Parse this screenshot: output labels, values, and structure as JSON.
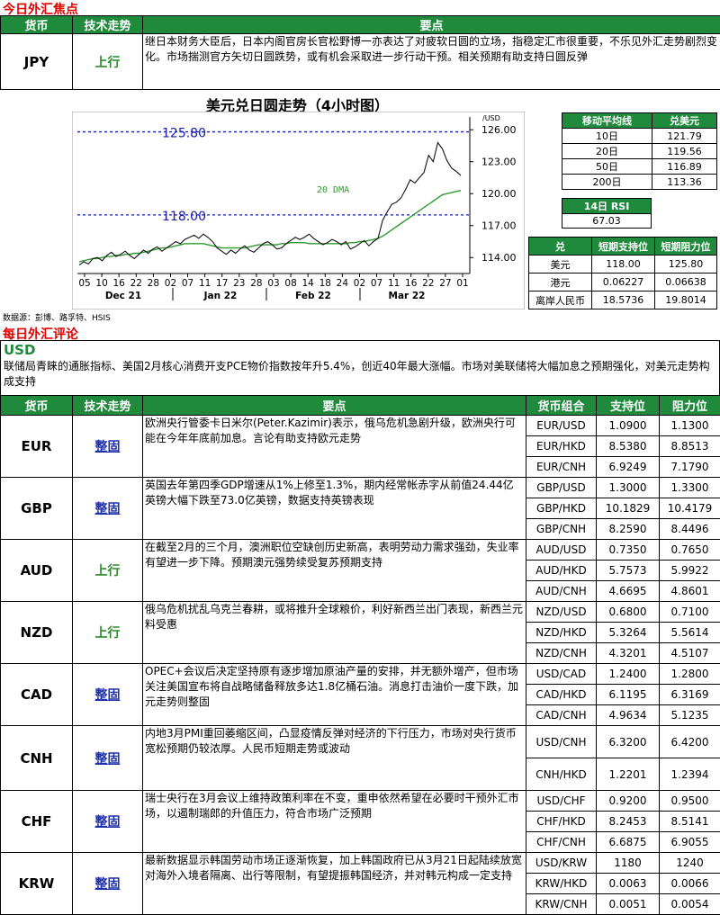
{
  "focus_title": "今日外汇焦点",
  "review_title": "每日外汇评论",
  "headers": {
    "currency": "货币",
    "trend": "技术走势",
    "points": "要点",
    "pair": "货币组合",
    "support": "支持位",
    "resistance": "阻力位"
  },
  "jpy": {
    "currency": "JPY",
    "trend": "上行",
    "text": "继日本财务大臣后，日本内阁官房长官松野博一亦表达了对疲软日圆的立场，指稳定汇市很重要，不乐见外汇走势剧烈变化。市场揣测官方矢切日圆跌势，或有机会采取进一步行动干预。相关预期有助支持日圆反弹"
  },
  "chart_data": {
    "type": "line",
    "title": "美元兑日圆走势（4小时图）",
    "y_unit": "/USD",
    "ylim": [
      112.5,
      127.2
    ],
    "y_ticks": [
      "126.00",
      "123.00",
      "120.00",
      "117.00",
      "114.00"
    ],
    "x_ticks": [
      "05",
      "10",
      "16",
      "22",
      "28",
      "02",
      "07",
      "11",
      "17",
      "23",
      "28",
      "03",
      "08",
      "14",
      "18",
      "24",
      "02",
      "07",
      "11",
      "16",
      "22",
      "27",
      "01"
    ],
    "x_groups": [
      "Dec 21",
      "Jan 22",
      "Feb 22",
      "Mar 22"
    ],
    "hlines": [
      {
        "value": 125.8,
        "label": "125.80"
      },
      {
        "value": 118.0,
        "label": "118.00"
      }
    ],
    "ma_label": "20 DMA",
    "price": [
      113.3,
      113.6,
      113.4,
      113.9,
      114.0,
      113.7,
      114.2,
      114.5,
      114.1,
      114.3,
      114.6,
      114.2,
      113.9,
      114.3,
      114.7,
      114.4,
      114.8,
      115.0,
      114.6,
      114.9,
      115.2,
      115.5,
      115.3,
      115.7,
      115.9,
      116.1,
      115.8,
      116.2,
      115.9,
      115.5,
      114.9,
      114.6,
      114.3,
      114.7,
      114.4,
      114.8,
      115.1,
      114.7,
      114.5,
      114.9,
      115.3,
      115.5,
      115.2,
      114.8,
      114.9,
      115.3,
      115.6,
      115.9,
      115.7,
      115.9,
      116.2,
      115.8,
      115.5,
      115.2,
      115.4,
      115.7,
      115.5,
      115.2,
      115.5,
      114.8,
      115.0,
      115.3,
      115.6,
      115.1,
      115.5,
      115.8,
      117.5,
      118.3,
      119.0,
      119.2,
      119.6,
      120.4,
      121.3,
      121.0,
      121.5,
      122.0,
      123.6,
      123.0,
      124.8,
      124.2,
      123.1,
      122.4,
      122.1,
      121.7
    ],
    "ma20": [
      113.6,
      113.7,
      113.8,
      113.9,
      113.9,
      114.0,
      114.1,
      114.1,
      114.2,
      114.2,
      114.3,
      114.3,
      114.4,
      114.4,
      114.5,
      114.6,
      114.7,
      114.8,
      114.9,
      114.9,
      115.0,
      115.1,
      115.2,
      115.3,
      115.3,
      115.3,
      115.3,
      115.3,
      115.2,
      115.1,
      115.0,
      114.9,
      114.9,
      114.9,
      114.9,
      114.9,
      114.9,
      115.0,
      115.1,
      115.2,
      115.2,
      115.2,
      115.2,
      115.2,
      115.3,
      115.3,
      115.4,
      115.4,
      115.4,
      115.4,
      115.3,
      115.3,
      115.3,
      115.3,
      115.3,
      115.3,
      115.3,
      115.3,
      115.3,
      115.4,
      115.4,
      115.5,
      115.5,
      115.6,
      115.7,
      115.8,
      116.0,
      116.3,
      116.6,
      116.9,
      117.2,
      117.5,
      117.8,
      118.1,
      118.4,
      118.7,
      119.0,
      119.3,
      119.6,
      119.9,
      120.0,
      120.1,
      120.2,
      120.3
    ]
  },
  "ma_table": {
    "header": [
      "移动平均线",
      "兑美元"
    ],
    "rows": [
      [
        "10日",
        "121.79"
      ],
      [
        "20日",
        "119.56"
      ],
      [
        "50日",
        "116.89"
      ],
      [
        "200日",
        "113.36"
      ]
    ]
  },
  "rsi": {
    "label": "14日 RSI",
    "value": "67.03"
  },
  "sr_table": {
    "header": [
      "兑",
      "短期支持位",
      "短期阻力位"
    ],
    "rows": [
      [
        "美元",
        "118.00",
        "125.80"
      ],
      [
        "港元",
        "0.06227",
        "0.06638"
      ],
      [
        "离岸人民币",
        "18.5736",
        "19.8014"
      ]
    ]
  },
  "source": "数据源：彭博、路孚特、HSIS",
  "usd": {
    "label": "USD",
    "text": "联储局青睐的通胀指标、美国2月核心消费开支PCE物价指数按年升5.4%，创近40年最大涨幅。市场对美联储将大幅加息之预期强化，对美元走势构成支持"
  },
  "rows": [
    {
      "currency": "EUR",
      "trend": "整固",
      "trend_type": "con",
      "text": "欧洲央行管委卡日米尔(Peter.Kazimir)表示，俄乌危机急剧升级，欧洲央行可能在今年年底前加息。言论有助支持欧元走势",
      "pairs": [
        [
          "EUR/USD",
          "1.0900",
          "1.1300"
        ],
        [
          "EUR/HKD",
          "8.5380",
          "8.8513"
        ],
        [
          "EUR/CNH",
          "6.9249",
          "7.1790"
        ]
      ]
    },
    {
      "currency": "GBP",
      "trend": "整固",
      "trend_type": "con",
      "text": "英国去年第四季GDP增速从1%上修至1.3%，期内经常帐赤字从前值24.44亿英镑大幅下跌至73.0亿英镑，数据支持英镑表现",
      "pairs": [
        [
          "GBP/USD",
          "1.3000",
          "1.3300"
        ],
        [
          "GBP/HKD",
          "10.1829",
          "10.4179"
        ],
        [
          "GBP/CNH",
          "8.2590",
          "8.4496"
        ]
      ]
    },
    {
      "currency": "AUD",
      "trend": "上行",
      "trend_type": "up",
      "text": "在截至2月的三个月，澳洲职位空缺创历史新高，表明劳动力需求强劲，失业率有望进一步下降。预期澳元强势续受复苏预期支持",
      "pairs": [
        [
          "AUD/USD",
          "0.7350",
          "0.7650"
        ],
        [
          "AUD/HKD",
          "5.7573",
          "5.9922"
        ],
        [
          "AUD/CNH",
          "4.6695",
          "4.8601"
        ]
      ]
    },
    {
      "currency": "NZD",
      "trend": "上行",
      "trend_type": "up",
      "text": "俄乌危机扰乱乌克兰春耕，或将推升全球粮价，利好新西兰出门表现，新西兰元料受惠",
      "pairs": [
        [
          "NZD/USD",
          "0.6800",
          "0.7100"
        ],
        [
          "NZD/HKD",
          "5.3264",
          "5.5614"
        ],
        [
          "NZD/CNH",
          "4.3201",
          "4.5107"
        ]
      ]
    },
    {
      "currency": "CAD",
      "trend": "整固",
      "trend_type": "con",
      "text": "OPEC+会议后决定坚持原有逐步增加原油产量的安排，并无额外增产，但市场关注美国宣布将自战略储备释放多达1.8亿桶石油。消息打击油价一度下跌，加元走势则整固",
      "pairs": [
        [
          "USD/CAD",
          "1.2400",
          "1.2800"
        ],
        [
          "CAD/HKD",
          "6.1195",
          "6.3169"
        ],
        [
          "CAD/CNH",
          "4.9634",
          "5.1235"
        ]
      ]
    },
    {
      "currency": "CNH",
      "trend": "整固",
      "trend_type": "con",
      "text": "内地3月PMI重回萎缩区间，凸显疫情反弹对经济的下行压力，市场对央行货币宽松预期仍较浓厚。人民币短期走势或波动",
      "pairs": [
        [
          "USD/CNH",
          "6.3200",
          "6.4200"
        ],
        [
          "CNH/HKD",
          "1.2201",
          "1.2394"
        ]
      ]
    },
    {
      "currency": "CHF",
      "trend": "整固",
      "trend_type": "con",
      "text": "瑞士央行在3月会议上维持政策利率在不变，重申依然希望在必要时干预外汇市场，以遏制瑞郎的升值压力，符合市场广泛预期",
      "pairs": [
        [
          "USD/CHF",
          "0.9200",
          "0.9500"
        ],
        [
          "CHF/HKD",
          "8.2453",
          "8.5141"
        ],
        [
          "CHF/CNH",
          "6.6875",
          "6.9055"
        ]
      ]
    },
    {
      "currency": "KRW",
      "trend": "整固",
      "trend_type": "con",
      "text": "最新数据显示韩国劳动市场正逐渐恢复，加上韩国政府已从3月21日起陆续放宽对海外入境者隔离、出行等限制，有望提振韩国经济，并对韩元构成一定支持",
      "pairs": [
        [
          "USD/KRW",
          "1180",
          "1240"
        ],
        [
          "KRW/HKD",
          "0.0063",
          "0.0066"
        ],
        [
          "KRW/CNH",
          "0.0051",
          "0.0054"
        ]
      ]
    }
  ]
}
